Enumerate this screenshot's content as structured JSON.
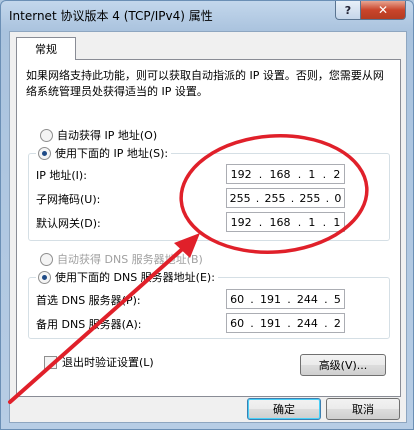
{
  "window": {
    "title": "Internet 协议版本 4 (TCP/IPv4) 属性",
    "help": "?",
    "close": "✕"
  },
  "tab": {
    "label": "常规"
  },
  "description": "如果网络支持此功能，则可以获取自动指派的 IP 设置。否则，您需要从网络系统管理员处获得适当的 IP 设置。",
  "ip_section": {
    "auto_label": "自动获得 IP 地址(O)",
    "manual_label": "使用下面的 IP 地址(S):",
    "selected": "manual",
    "fields": [
      {
        "label": "IP 地址(I):",
        "octets": [
          "192",
          "168",
          "1",
          "2"
        ]
      },
      {
        "label": "子网掩码(U):",
        "octets": [
          "255",
          "255",
          "255",
          "0"
        ]
      },
      {
        "label": "默认网关(D):",
        "octets": [
          "192",
          "168",
          "1",
          "1"
        ]
      }
    ]
  },
  "dns_section": {
    "auto_label": "自动获得 DNS 服务器地址(B)",
    "manual_label": "使用下面的 DNS 服务器地址(E):",
    "selected": "manual",
    "fields": [
      {
        "label": "首选 DNS 服务器(P):",
        "octets": [
          "60",
          "191",
          "244",
          "5"
        ]
      },
      {
        "label": "备用 DNS 服务器(A):",
        "octets": [
          "60",
          "191",
          "244",
          "2"
        ]
      }
    ]
  },
  "validate_label": "退出时验证设置(L)",
  "validate_checked": false,
  "advanced_button": "高级(V)...",
  "ok_button": "确定",
  "cancel_button": "取消",
  "annotation_color": "#e0202a"
}
